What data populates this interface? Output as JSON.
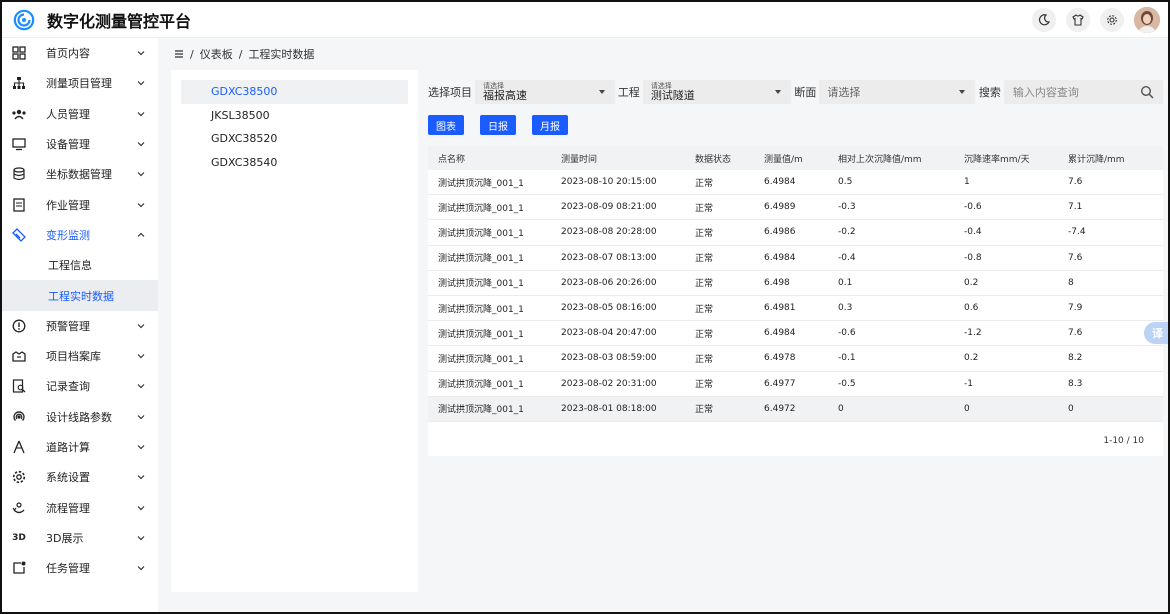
{
  "header": {
    "title": "数字化测量管控平台",
    "icons": [
      "moon-icon",
      "shirt-icon",
      "settings-gear-icon",
      "user-avatar"
    ]
  },
  "sidebar": {
    "items": [
      {
        "label": "首页内容",
        "icon": "dashboard-icon"
      },
      {
        "label": "测量项目管理",
        "icon": "org-tree-icon"
      },
      {
        "label": "人员管理",
        "icon": "people-icon"
      },
      {
        "label": "设备管理",
        "icon": "monitor-icon"
      },
      {
        "label": "坐标数据管理",
        "icon": "database-icon"
      },
      {
        "label": "作业管理",
        "icon": "document-icon"
      },
      {
        "label": "变形监测",
        "icon": "deform-icon"
      },
      {
        "label": "预警管理",
        "icon": "alert-icon"
      },
      {
        "label": "项目档案库",
        "icon": "archive-icon"
      },
      {
        "label": "记录查询",
        "icon": "search-record-icon"
      },
      {
        "label": "设计线路参数",
        "icon": "signal-icon"
      },
      {
        "label": "道路计算",
        "icon": "compass-icon"
      },
      {
        "label": "系统设置",
        "icon": "gear-icon"
      },
      {
        "label": "流程管理",
        "icon": "flow-icon"
      },
      {
        "label": "3D展示",
        "icon": "3d-icon"
      },
      {
        "label": "任务管理",
        "icon": "task-icon"
      }
    ],
    "subitems": [
      "工程信息",
      "工程实时数据"
    ]
  },
  "breadcrumb": {
    "home": "仪表板",
    "current": "工程实时数据"
  },
  "projects": [
    "GDXC38500",
    "JKSL38500",
    "GDXC38520",
    "GDXC38540"
  ],
  "filters": {
    "project_label": "选择项目",
    "project_hint": "请选择",
    "project_value": "福报高速",
    "engineering_label": "工程",
    "engineering_hint": "请选择",
    "engineering_value": "测试隧道",
    "section_label": "断面",
    "section_placeholder": "请选择",
    "search_label": "搜索",
    "search_placeholder": "输入内容查询"
  },
  "buttons": {
    "chart": "图表",
    "daily": "日报",
    "monthly": "月报"
  },
  "table": {
    "columns": [
      "点名称",
      "测量时间",
      "数据状态",
      "测量值/m",
      "相对上次沉降值/mm",
      "沉降速率mm/天",
      "累计沉降/mm"
    ],
    "rows": [
      [
        "测试拱顶沉降_001_1",
        "2023-08-10 20:15:00",
        "正常",
        "6.4984",
        "0.5",
        "1",
        "7.6"
      ],
      [
        "测试拱顶沉降_001_1",
        "2023-08-09 08:21:00",
        "正常",
        "6.4989",
        "-0.3",
        "-0.6",
        "7.1"
      ],
      [
        "测试拱顶沉降_001_1",
        "2023-08-08 20:28:00",
        "正常",
        "6.4986",
        "-0.2",
        "-0.4",
        "-7.4"
      ],
      [
        "测试拱顶沉降_001_1",
        "2023-08-07 08:13:00",
        "正常",
        "6.4984",
        "-0.4",
        "-0.8",
        "7.6"
      ],
      [
        "测试拱顶沉降_001_1",
        "2023-08-06 20:26:00",
        "正常",
        "6.498",
        "0.1",
        "0.2",
        "8"
      ],
      [
        "测试拱顶沉降_001_1",
        "2023-08-05 08:16:00",
        "正常",
        "6.4981",
        "0.3",
        "0.6",
        "7.9"
      ],
      [
        "测试拱顶沉降_001_1",
        "2023-08-04 20:47:00",
        "正常",
        "6.4984",
        "-0.6",
        "-1.2",
        "7.6"
      ],
      [
        "测试拱顶沉降_001_1",
        "2023-08-03 08:59:00",
        "正常",
        "6.4978",
        "-0.1",
        "0.2",
        "8.2"
      ],
      [
        "测试拱顶沉降_001_1",
        "2023-08-02 20:31:00",
        "正常",
        "6.4977",
        "-0.5",
        "-1",
        "8.3"
      ],
      [
        "测试拱顶沉降_001_1",
        "2023-08-01 08:18:00",
        "正常",
        "6.4972",
        "0",
        "0",
        "0"
      ]
    ],
    "pagination": "1-10 / 10"
  },
  "translate_button": "译",
  "colors": {
    "accent": "#1a5cff",
    "sidebar_selected": "#ebedf0"
  }
}
